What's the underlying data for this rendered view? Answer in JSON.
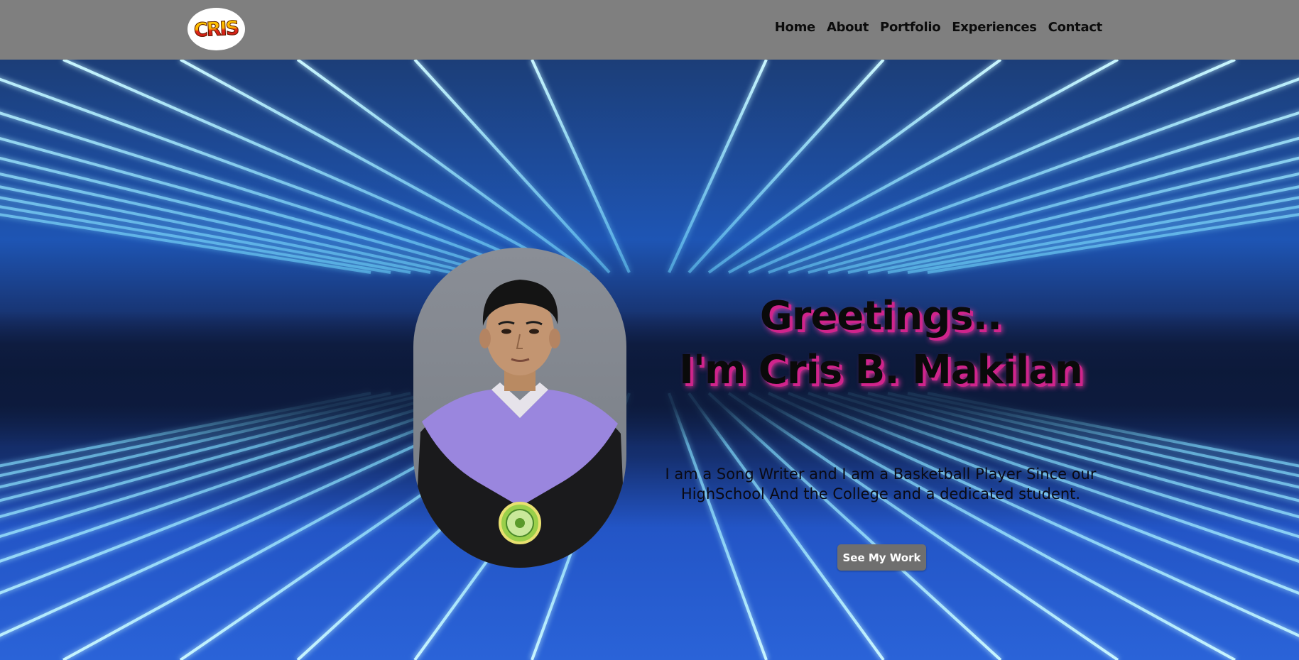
{
  "header": {
    "logo_text": "CRIS",
    "nav": [
      {
        "label": "Home"
      },
      {
        "label": "About"
      },
      {
        "label": "Portfolio"
      },
      {
        "label": "Experiences"
      },
      {
        "label": "Contact"
      }
    ]
  },
  "hero": {
    "greeting": "Greetings..",
    "name_line": "I'm Cris B. Makilan",
    "bio": "I am a Song Writer and I am a Basketball Player Since our HighSchool And the College and a dedicated student.",
    "cta_label": "See My Work"
  },
  "colors": {
    "header_bg": "#7f7f7f",
    "text_shadow": "#d0248c",
    "cta_bg": "#6f6f6f",
    "grid_line": "#8fe8ff"
  },
  "icons": {
    "logo": "cris-logo",
    "portrait": "graduation-portrait"
  }
}
